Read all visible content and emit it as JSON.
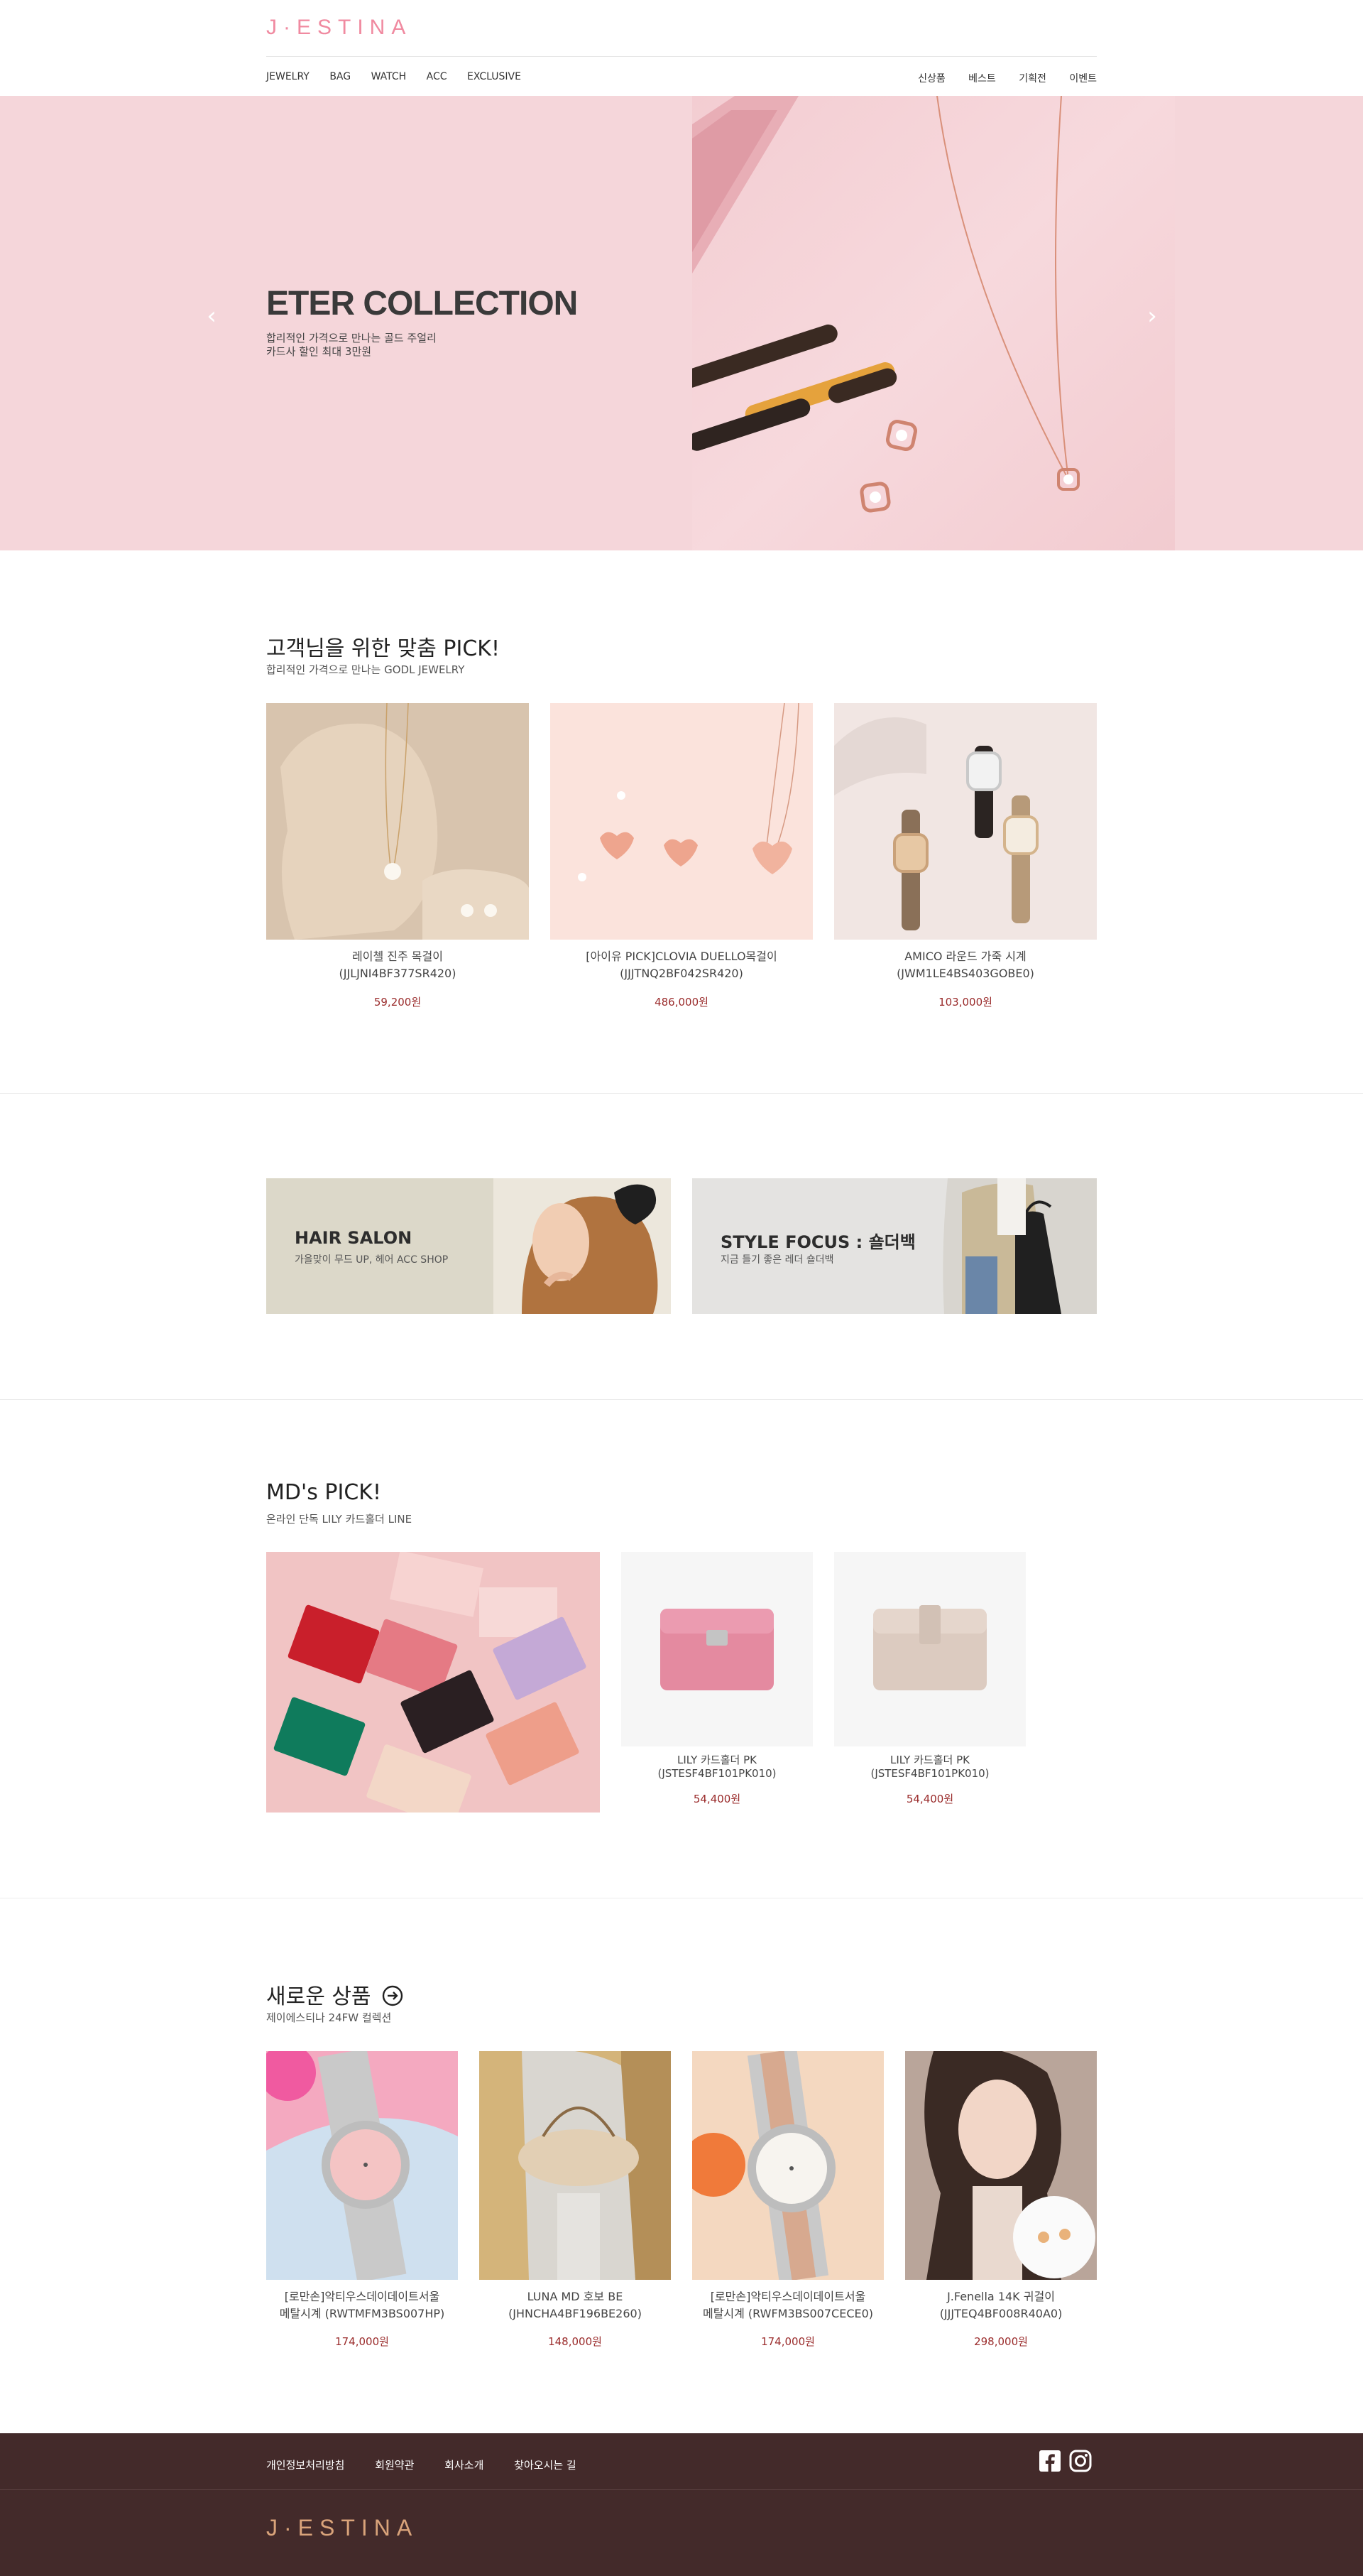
{
  "header": {
    "logo": "J·ESTINA",
    "nav_left": [
      "JEWELRY",
      "BAG",
      "WATCH",
      "ACC",
      "EXCLUSIVE"
    ],
    "nav_right": [
      "신상품",
      "베스트",
      "기획전",
      "이벤트"
    ]
  },
  "hero": {
    "title": "ETER COLLECTION",
    "subtitle_line1": "합리적인 가격으로 만나는 골드 주얼리",
    "subtitle_line2": "카드사 할인 최대 3만원",
    "prev": "‹",
    "next": "›",
    "bg_color": "#f5d6da"
  },
  "pick": {
    "title": "고객님을 위한 맞춤 PICK!",
    "subtitle": "합리적인 가격으로 만나는 GODL JEWELRY",
    "items": [
      {
        "name1": "레이첼 진주 목걸이",
        "name2": "(JJLJNI4BF377SR420)",
        "price": "59,200원"
      },
      {
        "name1": "[아이유 PICK]CLOVIA DUELLO목걸이",
        "name2": "(JJJTNQ2BF042SR420)",
        "price": "486,000원"
      },
      {
        "name1": "AMICO 라운드 가죽 시계",
        "name2": "(JWM1LE4BS403GOBE0)",
        "price": "103,000원"
      }
    ]
  },
  "banners": [
    {
      "title": "HAIR SALON",
      "subtitle": "가을맞이 무드 UP, 헤어 ACC SHOP"
    },
    {
      "title": "STYLE FOCUS : 숄더백",
      "subtitle": "지금 들기 좋은 레더 숄더백"
    }
  ],
  "md": {
    "title": "MD's PICK!",
    "subtitle": "온라인 단독 LILY 카드홀더 LINE",
    "items": [
      {
        "name1": "LILY 카드홀더 PK",
        "name2": "(JSTESF4BF101PK010)",
        "price": "54,400원"
      },
      {
        "name1": "LILY 카드홀더 PK",
        "name2": "(JSTESF4BF101PK010)",
        "price": "54,400원"
      }
    ]
  },
  "new": {
    "title": "새로운 상품",
    "subtitle": "제이에스티나 24FW 컬렉션",
    "items": [
      {
        "name1": "[로만손]악티우스데이데이트서울",
        "name2": "메탈시계 (RWTMFM3BS007HP)",
        "price": "174,000원"
      },
      {
        "name1": "LUNA MD 호보 BE",
        "name2": "(JHNCHA4BF196BE260)",
        "price": "148,000원"
      },
      {
        "name1": "[로만손]악티우스데이데이트서울",
        "name2": "메탈시계 (RWFM3BS007CECE0)",
        "price": "174,000원"
      },
      {
        "name1": "J.Fenella 14K 귀걸이",
        "name2": "(JJJTEQ4BF008R40A0)",
        "price": "298,000원"
      }
    ]
  },
  "footer": {
    "links": [
      "개인정보처리방침",
      "회원약관",
      "회사소개",
      "찾아오시는 길"
    ],
    "logo": "J·ESTINA",
    "bg_color": "#432a2a"
  }
}
